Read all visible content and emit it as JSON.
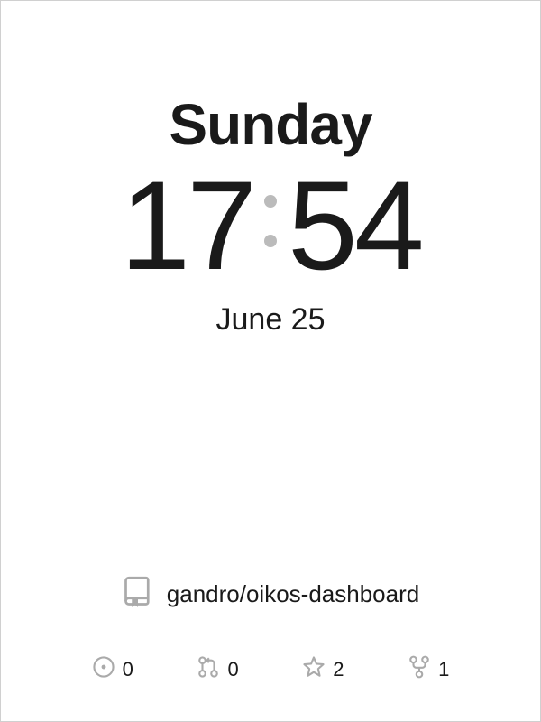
{
  "clock": {
    "day": "Sunday",
    "hours": "17",
    "minutes": "54",
    "date": "June 25"
  },
  "repo": {
    "name": "gandro/oikos-dashboard"
  },
  "stats": {
    "issues": "0",
    "pull_requests": "0",
    "stars": "2",
    "forks": "1"
  }
}
